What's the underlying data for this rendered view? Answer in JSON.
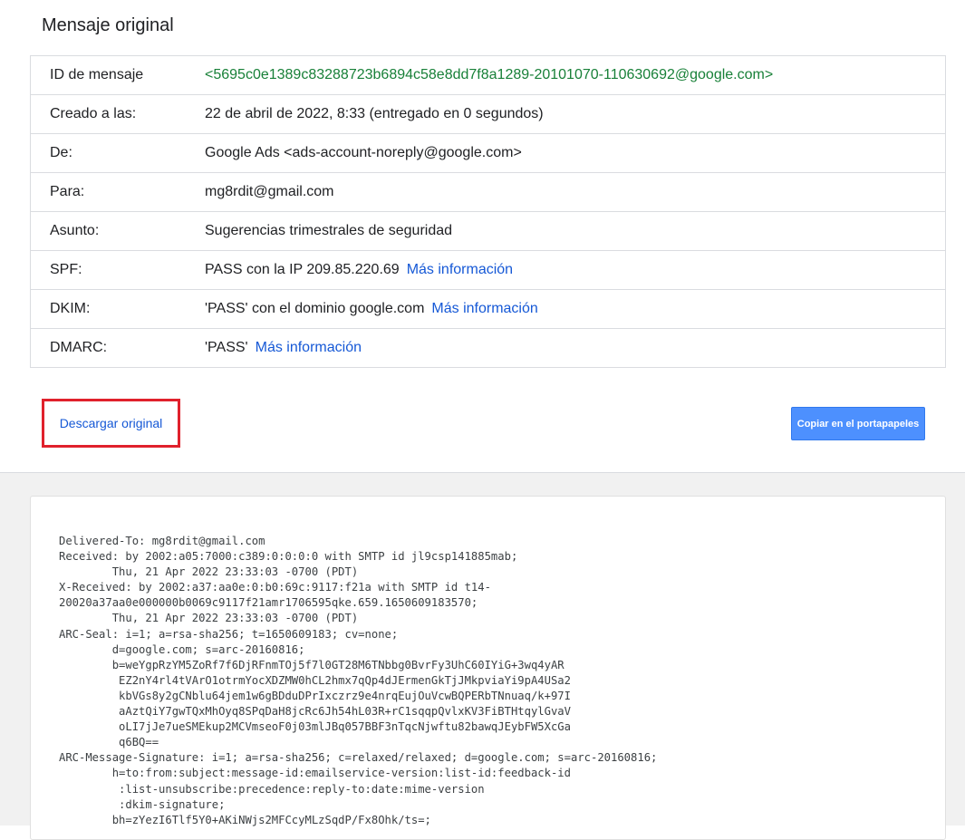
{
  "page": {
    "title": "Mensaje original"
  },
  "headers": [
    {
      "label": "ID de mensaje",
      "value": "<5695c0e1389c83288723b6894c58e8dd7f8a1289-20101070-110630692@google.com>"
    },
    {
      "label": "Creado a las:",
      "value": "22 de abril de 2022, 8:33 (entregado en 0 segundos)"
    },
    {
      "label": "De:",
      "value": "Google Ads <ads-account-noreply@google.com>"
    },
    {
      "label": "Para:",
      "value": "mg8rdit@gmail.com"
    },
    {
      "label": "Asunto:",
      "value": "Sugerencias trimestrales de seguridad"
    },
    {
      "label": "SPF:",
      "value": "PASS con la IP 209.85.220.69",
      "link": "Más información"
    },
    {
      "label": "DKIM:",
      "value": "'PASS' con el dominio google.com",
      "link": "Más información"
    },
    {
      "label": "DMARC:",
      "value": "'PASS'",
      "link": "Más información"
    }
  ],
  "actions": {
    "download_label": "Descargar original",
    "copy_label": "Copiar en el portapapeles"
  },
  "raw_message": "Delivered-To: mg8rdit@gmail.com\nReceived: by 2002:a05:7000:c389:0:0:0:0 with SMTP id jl9csp141885mab;\n        Thu, 21 Apr 2022 23:33:03 -0700 (PDT)\nX-Received: by 2002:a37:aa0e:0:b0:69c:9117:f21a with SMTP id t14-\n20020a37aa0e000000b0069c9117f21amr1706595qke.659.1650609183570;\n        Thu, 21 Apr 2022 23:33:03 -0700 (PDT)\nARC-Seal: i=1; a=rsa-sha256; t=1650609183; cv=none;\n        d=google.com; s=arc-20160816;\n        b=weYgpRzYM5ZoRf7f6DjRFnmTOj5f7l0GT28M6TNbbg0BvrFy3UhC60IYiG+3wq4yAR\n         EZ2nY4rl4tVArO1otrmYocXDZMW0hCL2hmx7qQp4dJErmenGkTjJMkpviaYi9pA4USa2\n         kbVGs8y2gCNblu64jem1w6gBDduDPrIxczrz9e4nrqEujOuVcwBQPERbTNnuaq/k+97I\n         aAztQiY7gwTQxMhOyq8SPqDaH8jcRc6Jh54hL03R+rC1sqqpQvlxKV3FiBTHtqylGvaV\n         oLI7jJe7ueSMEkup2MCVmseoF0j03mlJBq057BBF3nTqcNjwftu82bawqJEybFW5XcGa\n         q6BQ==\nARC-Message-Signature: i=1; a=rsa-sha256; c=relaxed/relaxed; d=google.com; s=arc-20160816;\n        h=to:from:subject:message-id:emailservice-version:list-id:feedback-id\n         :list-unsubscribe:precedence:reply-to:date:mime-version\n         :dkim-signature;\n        bh=zYezI6Tlf5Y0+AKiNWjs2MFCcyMLzSqdP/Fx8Ohk/ts=;"
}
